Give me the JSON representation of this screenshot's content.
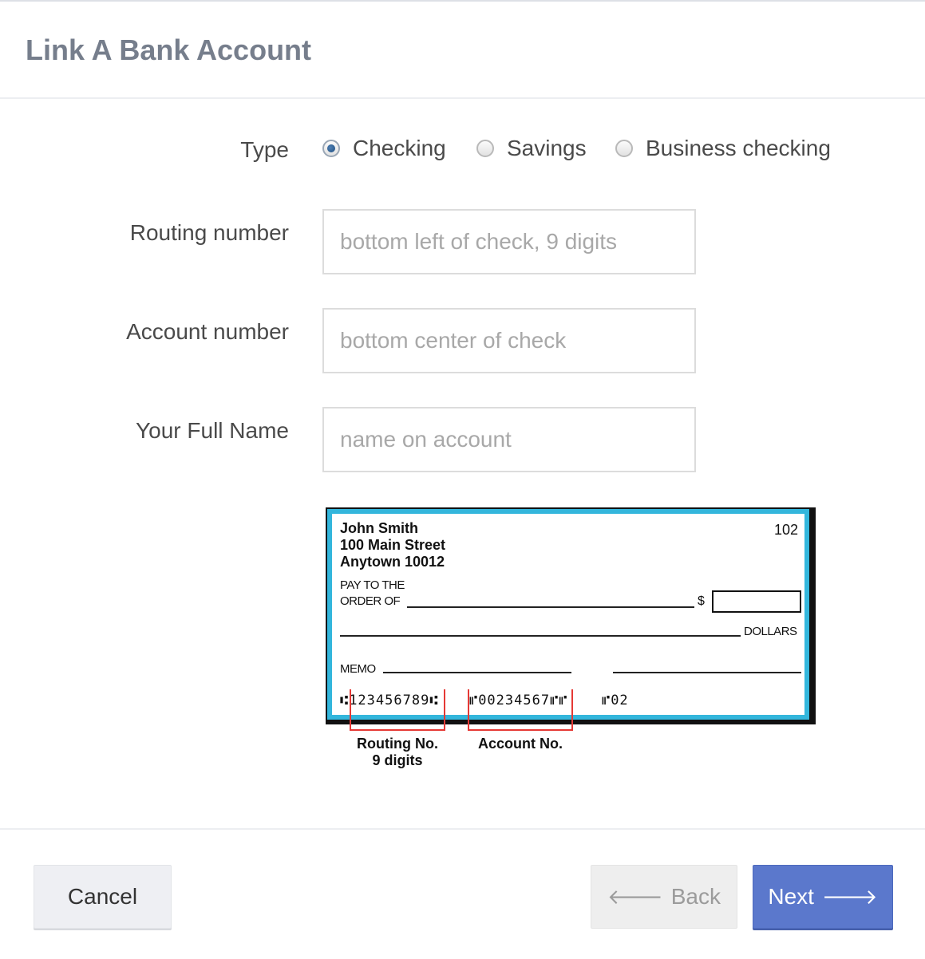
{
  "header": {
    "title": "Link A Bank Account"
  },
  "form": {
    "type_label": "Type",
    "type_options": [
      {
        "label": "Checking",
        "checked": true
      },
      {
        "label": "Savings",
        "checked": false
      },
      {
        "label": "Business checking",
        "checked": false
      }
    ],
    "routing": {
      "label": "Routing number",
      "placeholder": "bottom left of check, 9 digits",
      "value": ""
    },
    "account": {
      "label": "Account number",
      "placeholder": "bottom center of check",
      "value": ""
    },
    "full_name": {
      "label": "Your Full Name",
      "placeholder": "name on account",
      "value": ""
    }
  },
  "check_image": {
    "name": "John Smith",
    "street": "100 Main Street",
    "city": "Anytown 10012",
    "check_number": "102",
    "pay_to_line1": "PAY TO THE",
    "pay_to_line2": "ORDER OF",
    "dollar_sign": "$",
    "dollars": "DOLLARS",
    "memo": "MEMO",
    "micr_routing": "⑆123456789⑆",
    "micr_account": "⑈00234567⑈⑈",
    "micr_check": "⑈02",
    "routing_caption_line1": "Routing No.",
    "routing_caption_line2": "9 digits",
    "account_caption": "Account No."
  },
  "footer": {
    "cancel_label": "Cancel",
    "back_label": "Back",
    "next_label": "Next"
  },
  "icons": {
    "back": "arrow-left-icon",
    "next": "arrow-right-icon"
  },
  "colors": {
    "primary": "#5b78cc",
    "check_border": "#33b6dc",
    "bracket": "#e53935"
  }
}
